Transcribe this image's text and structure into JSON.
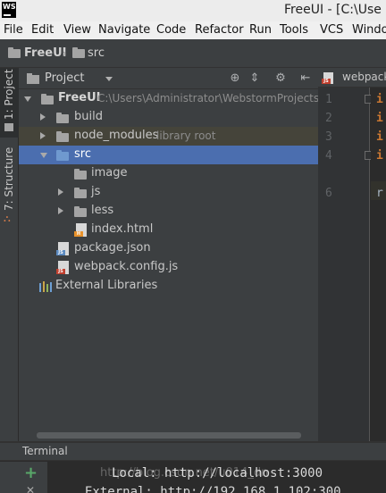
{
  "window": {
    "title": "FreeUI - [C:\\Use",
    "logo_text": "WS"
  },
  "menu": [
    {
      "label": "File"
    },
    {
      "label": "Edit"
    },
    {
      "label": "View"
    },
    {
      "label": "Navigate"
    },
    {
      "label": "Code"
    },
    {
      "label": "Refactor"
    },
    {
      "label": "Run"
    },
    {
      "label": "Tools"
    },
    {
      "label": "VCS"
    },
    {
      "label": "Windo"
    }
  ],
  "breadcrumb": {
    "root": "FreeUI",
    "child": "src"
  },
  "tool_windows": {
    "project": "1: Project",
    "structure": "7: Structure"
  },
  "project_panel": {
    "view_selector": "Project",
    "icons": [
      "target-icon",
      "collapse-icon",
      "gear-icon",
      "hide-icon"
    ],
    "tree": {
      "root": {
        "label": "FreeUI",
        "path": "C:\\Users\\Administrator\\WebstormProjects\\"
      },
      "build": {
        "label": "build"
      },
      "node_modules": {
        "label": "node_modules",
        "hint": "library root"
      },
      "src": {
        "label": "src"
      },
      "image": {
        "label": "image"
      },
      "js": {
        "label": "js"
      },
      "less": {
        "label": "less"
      },
      "index_html": {
        "label": "index.html"
      },
      "package_json": {
        "label": "package.json"
      },
      "webpack_config": {
        "label": "webpack.config.js"
      },
      "external_libraries": {
        "label": "External Libraries"
      }
    }
  },
  "editor": {
    "tab_label": "webpack",
    "line_numbers": [
      "1",
      "2",
      "3",
      "4",
      "6"
    ],
    "code_lines": [
      "i",
      "i",
      "i",
      "i",
      "r"
    ]
  },
  "terminal": {
    "title": "Terminal",
    "lines": [
      "Local: http://localhost:3000",
      "External: http://192.168.1.102:300"
    ],
    "watermark": "http://blog.csdn.net/u014_dn"
  }
}
